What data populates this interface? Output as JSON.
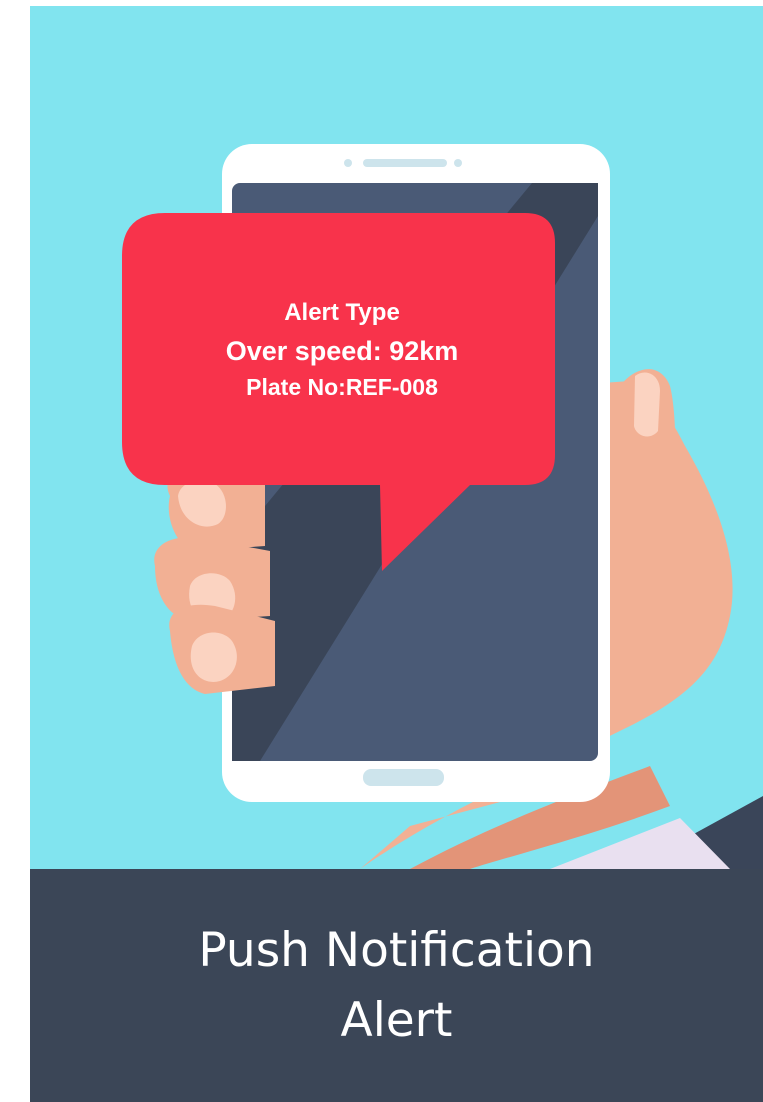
{
  "illustration": {
    "description_icon": "hand-holding-phone-illustration",
    "background_color": "#81e4ef",
    "bubble_color": "#f8334b",
    "screen_color": "#4a5a76"
  },
  "notification": {
    "line1": "Alert Type",
    "line2": "Over speed: 92km",
    "line3": "Plate No:REF-008"
  },
  "caption": {
    "line1": "Push Notification",
    "line2": "Alert",
    "background_color": "#3b4657"
  }
}
